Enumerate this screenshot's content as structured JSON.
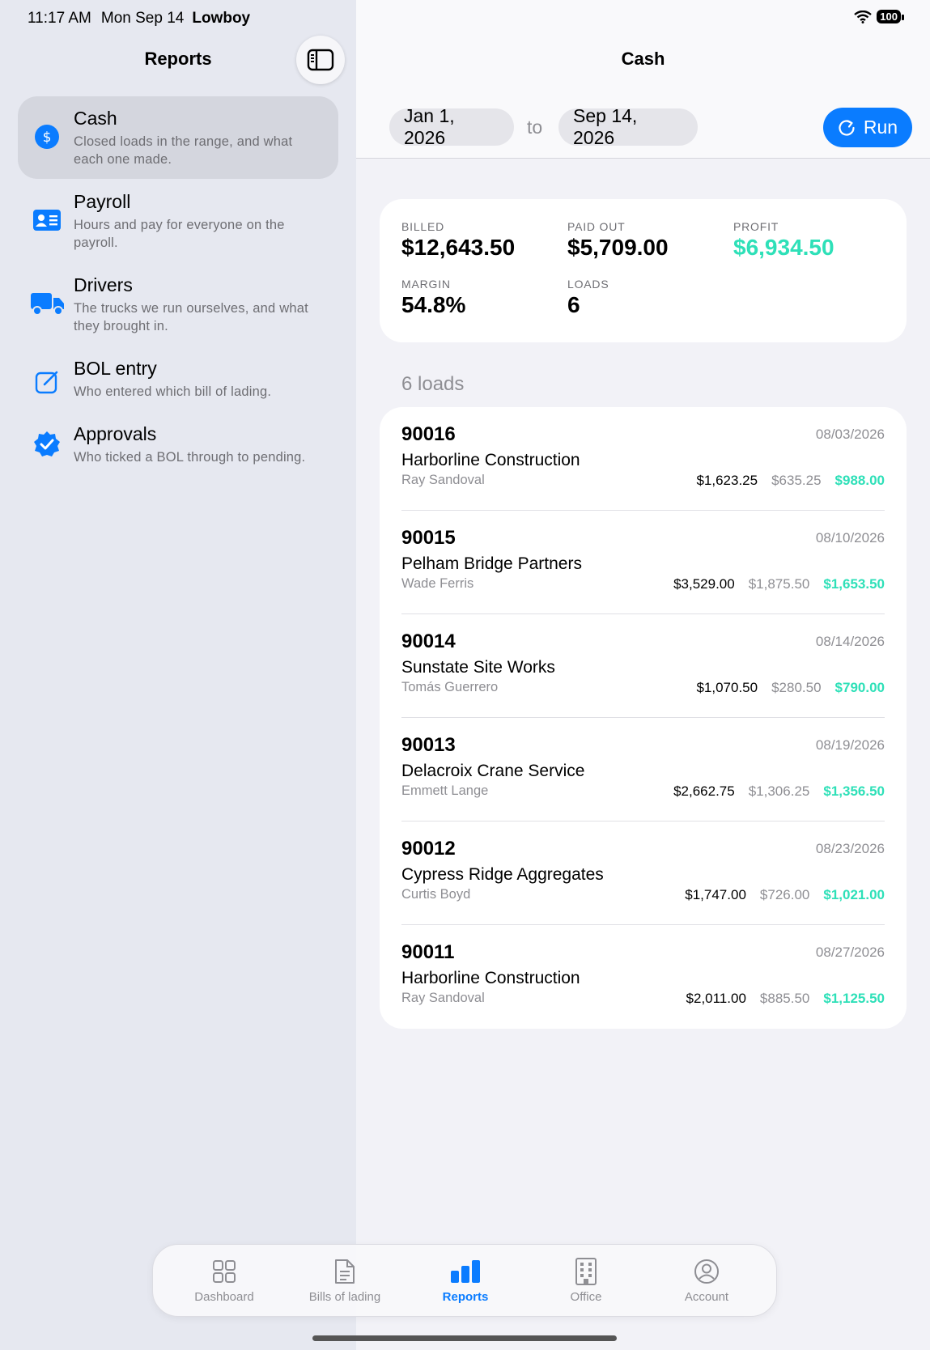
{
  "status": {
    "time": "11:17 AM",
    "date": "Mon Sep 14",
    "device": "Lowboy",
    "battery": "100"
  },
  "sidebar": {
    "title": "Reports",
    "items": [
      {
        "label": "Cash",
        "desc": "Closed loads in the range, and what each one made.",
        "icon": "dollar-circle-icon"
      },
      {
        "label": "Payroll",
        "desc": "Hours and pay for everyone on the payroll.",
        "icon": "person-card-icon"
      },
      {
        "label": "Drivers",
        "desc": "The trucks we run ourselves, and what they brought in.",
        "icon": "truck-icon"
      },
      {
        "label": "BOL entry",
        "desc": "Who entered which bill of lading.",
        "icon": "pencil-square-icon"
      },
      {
        "label": "Approvals",
        "desc": "Who ticked a BOL through to pending.",
        "icon": "checkmark-seal-icon"
      }
    ]
  },
  "main": {
    "title": "Cash",
    "from_date": "Jan 1, 2026",
    "to_label": "to",
    "to_date": "Sep 14, 2026",
    "run_label": "Run"
  },
  "summary": {
    "billed_label": "BILLED",
    "billed": "$12,643.50",
    "paid_label": "PAID OUT",
    "paid": "$5,709.00",
    "profit_label": "PROFIT",
    "profit": "$6,934.50",
    "margin_label": "MARGIN",
    "margin": "54.8%",
    "loads_label": "LOADS",
    "loads": "6"
  },
  "loads_heading": "6 loads",
  "loads": [
    {
      "id": "90016",
      "date": "08/03/2026",
      "customer": "Harborline Construction",
      "driver": "Ray Sandoval",
      "billed": "$1,623.25",
      "paid": "$635.25",
      "profit": "$988.00"
    },
    {
      "id": "90015",
      "date": "08/10/2026",
      "customer": "Pelham Bridge Partners",
      "driver": "Wade Ferris",
      "billed": "$3,529.00",
      "paid": "$1,875.50",
      "profit": "$1,653.50"
    },
    {
      "id": "90014",
      "date": "08/14/2026",
      "customer": "Sunstate Site Works",
      "driver": "Tomás Guerrero",
      "billed": "$1,070.50",
      "paid": "$280.50",
      "profit": "$790.00"
    },
    {
      "id": "90013",
      "date": "08/19/2026",
      "customer": "Delacroix Crane Service",
      "driver": "Emmett Lange",
      "billed": "$2,662.75",
      "paid": "$1,306.25",
      "profit": "$1,356.50"
    },
    {
      "id": "90012",
      "date": "08/23/2026",
      "customer": "Cypress Ridge Aggregates",
      "driver": "Curtis Boyd",
      "billed": "$1,747.00",
      "paid": "$726.00",
      "profit": "$1,021.00"
    },
    {
      "id": "90011",
      "date": "08/27/2026",
      "customer": "Harborline Construction",
      "driver": "Ray Sandoval",
      "billed": "$2,011.00",
      "paid": "$885.50",
      "profit": "$1,125.50"
    }
  ],
  "tabs": [
    {
      "label": "Dashboard",
      "icon": "grid-icon"
    },
    {
      "label": "Bills of lading",
      "icon": "document-icon"
    },
    {
      "label": "Reports",
      "icon": "bar-chart-icon",
      "active": true
    },
    {
      "label": "Office",
      "icon": "building-icon"
    },
    {
      "label": "Account",
      "icon": "person-circle-icon"
    }
  ],
  "colors": {
    "accent": "#0a7cff",
    "profit": "#2ee0b8"
  }
}
